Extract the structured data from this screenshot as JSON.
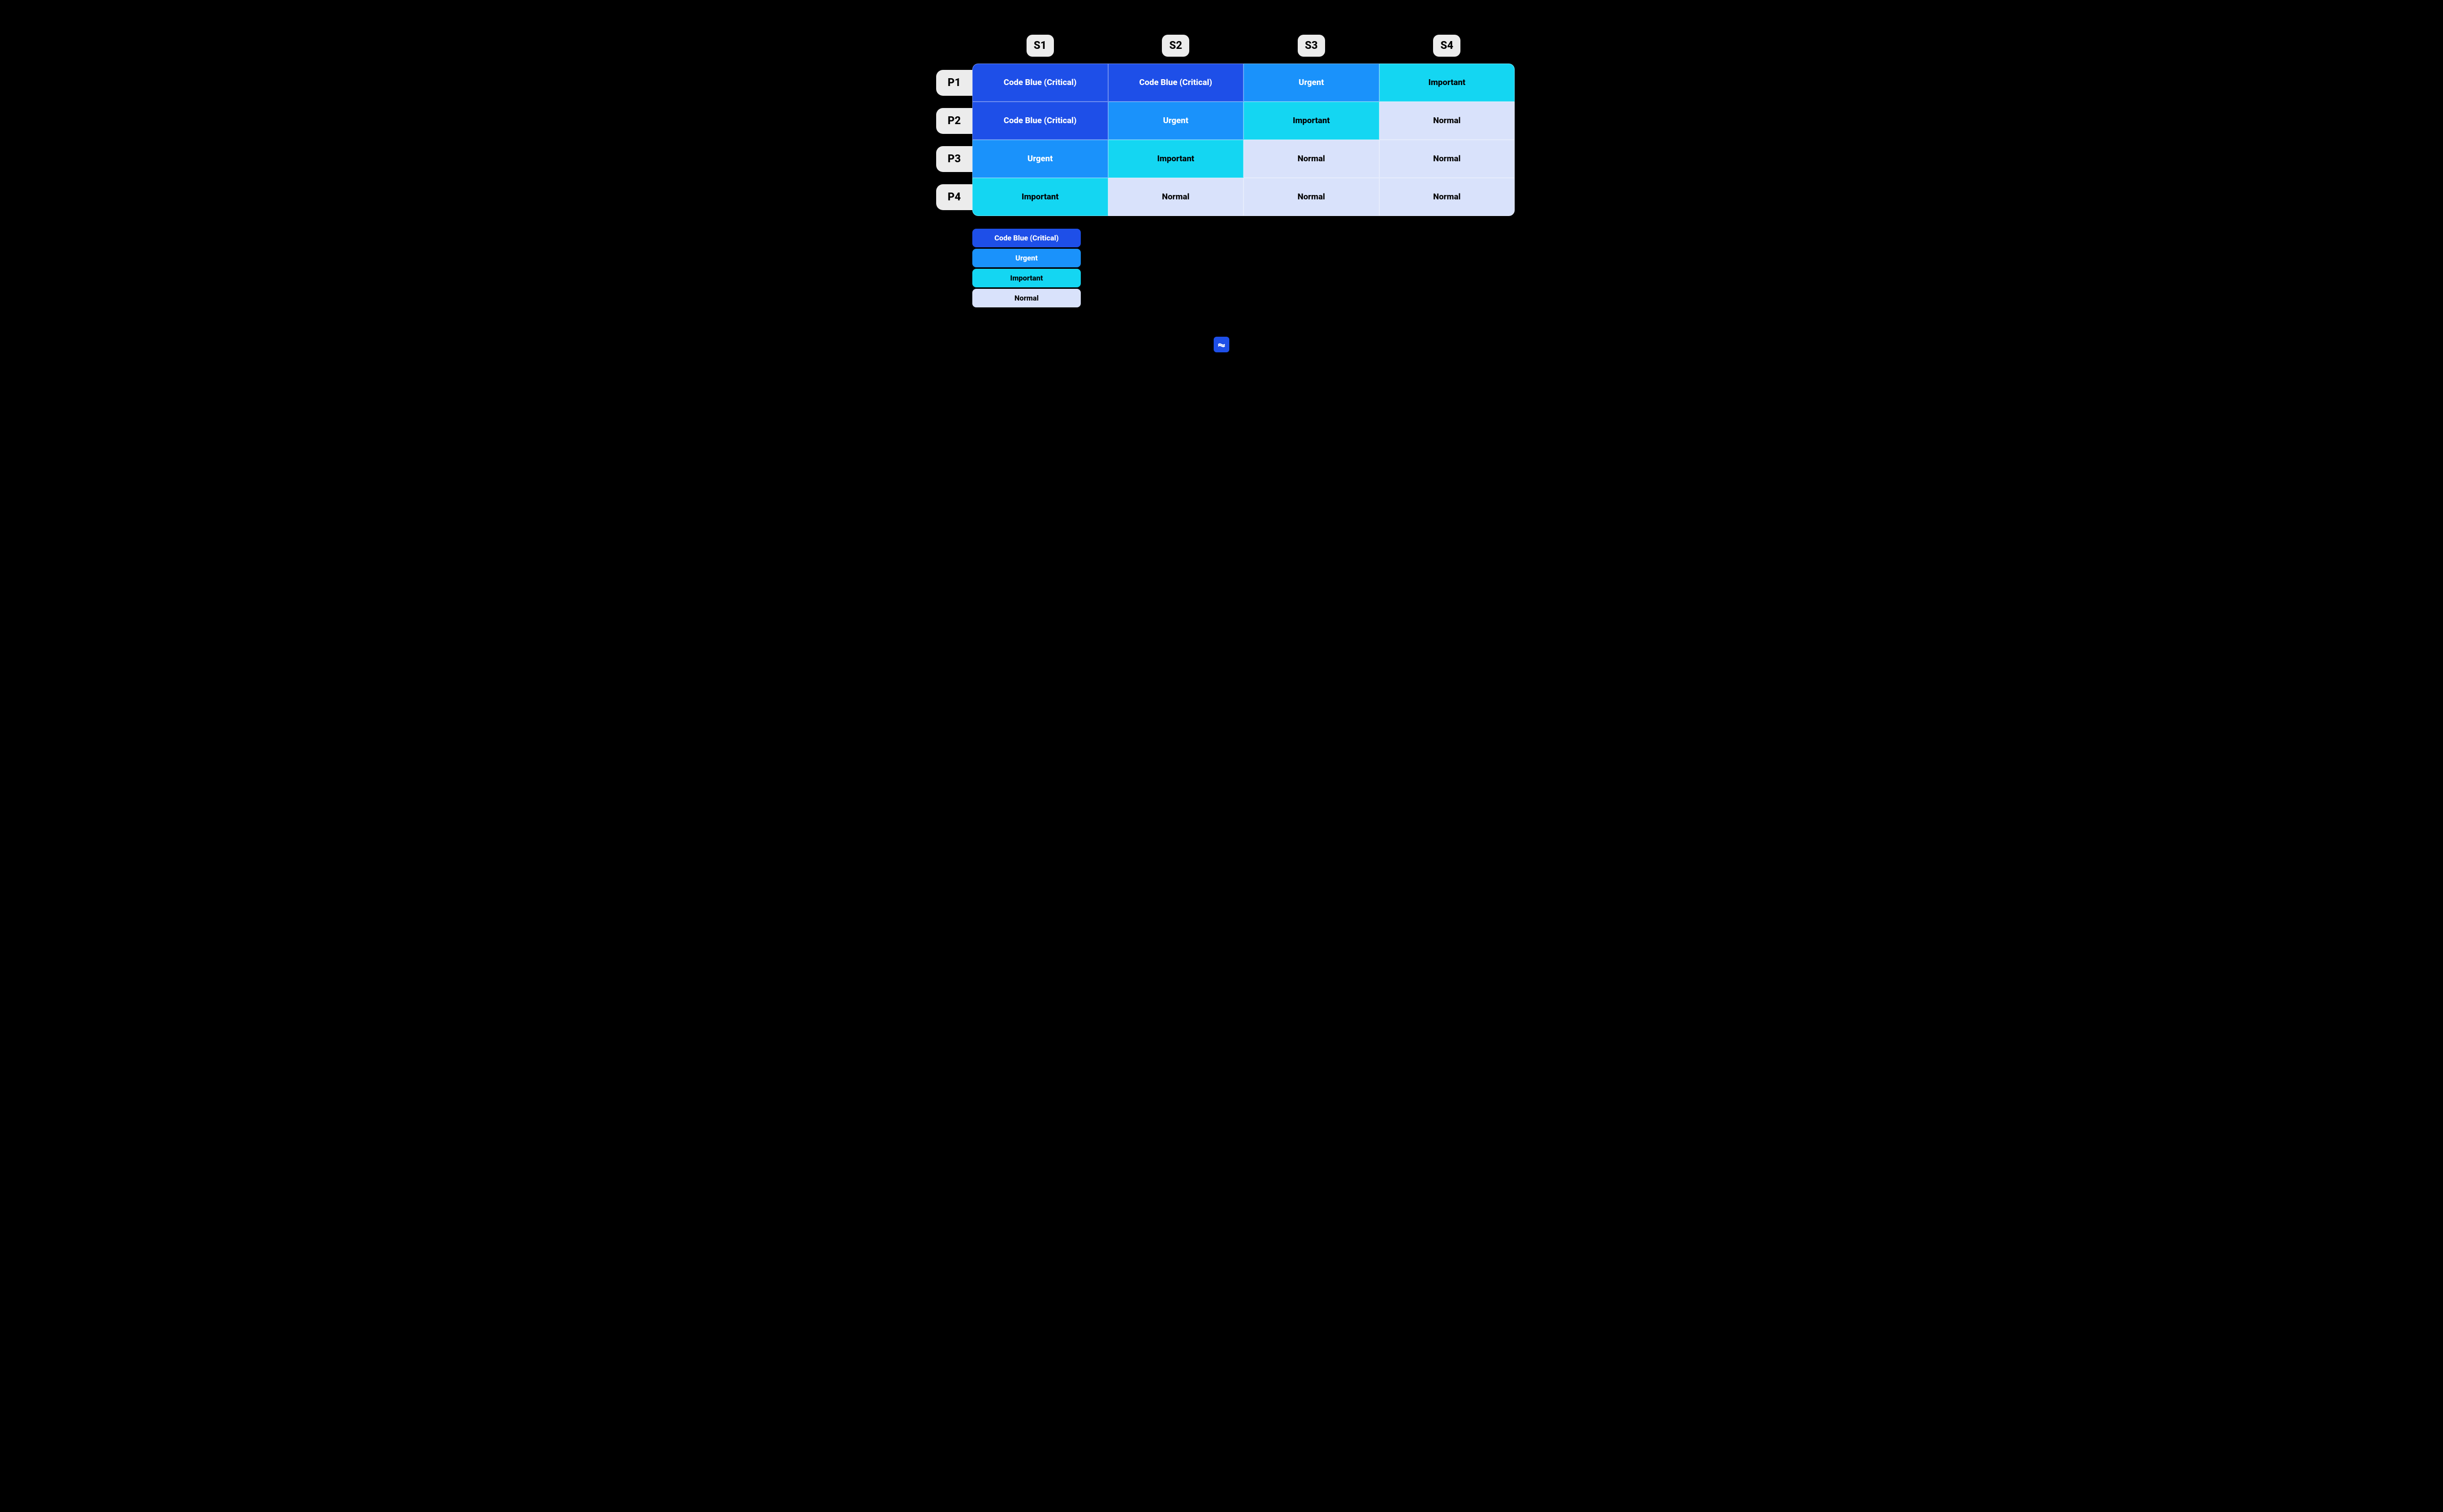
{
  "columns": [
    "S1",
    "S2",
    "S3",
    "S4"
  ],
  "rows": [
    "P1",
    "P2",
    "P3",
    "P4"
  ],
  "levels": {
    "critical": {
      "label": "Code Blue (Critical)"
    },
    "urgent": {
      "label": "Urgent"
    },
    "important": {
      "label": "Important"
    },
    "normal": {
      "label": "Normal"
    }
  },
  "matrix": [
    [
      "critical",
      "critical",
      "urgent",
      "important"
    ],
    [
      "critical",
      "urgent",
      "important",
      "normal"
    ],
    [
      "urgent",
      "important",
      "normal",
      "normal"
    ],
    [
      "important",
      "normal",
      "normal",
      "normal"
    ]
  ],
  "legend_order": [
    "critical",
    "urgent",
    "important",
    "normal"
  ]
}
